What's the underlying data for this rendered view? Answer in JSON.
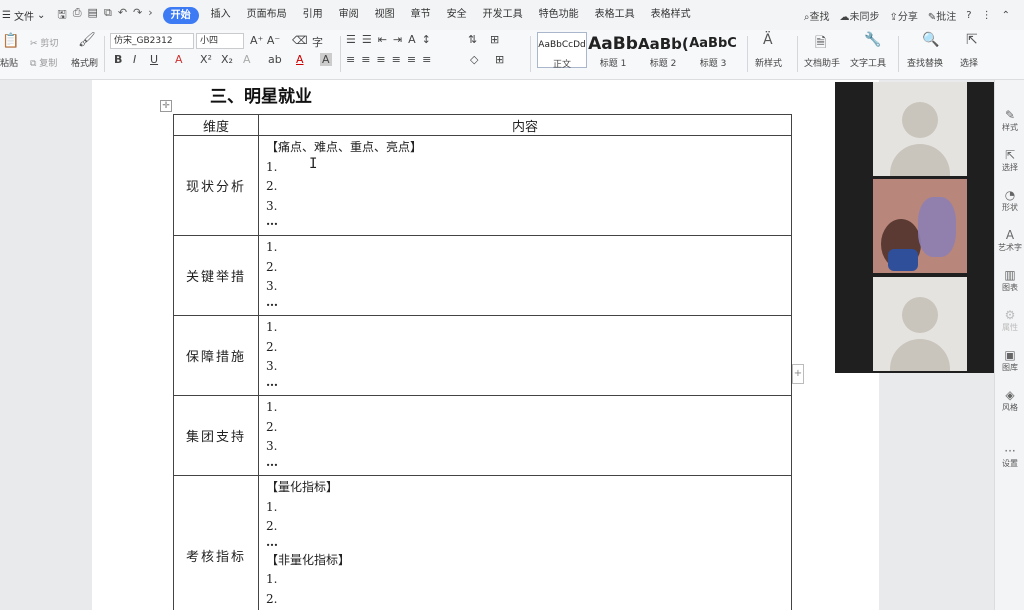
{
  "menu": {
    "file_label": "文件",
    "tabs": [
      "开始",
      "插入",
      "页面布局",
      "引用",
      "审阅",
      "视图",
      "章节",
      "安全",
      "开发工具",
      "特色功能",
      "表格工具",
      "表格样式"
    ],
    "active_tab": "开始",
    "search_label": "查找",
    "sync_label": "未同步",
    "share_label": "分享",
    "annotate_label": "批注"
  },
  "ribbon": {
    "paste": "粘贴",
    "cut": "剪切",
    "copy": "复制",
    "format_painter": "格式刷",
    "font_name": "仿宋_GB2312",
    "font_size": "小四",
    "styles": [
      {
        "sample": "AaBbCcDd",
        "label": "正文"
      },
      {
        "sample": "AaBb",
        "label": "标题 1"
      },
      {
        "sample": "AaBb(",
        "label": "标题 2"
      },
      {
        "sample": "AaBbC",
        "label": "标题 3"
      }
    ],
    "new_style": "新样式",
    "doc_assistant": "文档助手",
    "text_tools": "文字工具",
    "find_replace": "查找替换",
    "select": "选择"
  },
  "document": {
    "heading": "三、明星就业",
    "table": {
      "headers": [
        "维度",
        "内容"
      ],
      "rows": [
        {
          "dimension": "现状分析",
          "lines": [
            "【痛点、难点、重点、亮点】",
            "1.",
            "2.",
            "3.",
            "…"
          ]
        },
        {
          "dimension": "关键举措",
          "lines": [
            "1.",
            "2.",
            "3.",
            "…"
          ]
        },
        {
          "dimension": "保障措施",
          "lines": [
            "1.",
            "2.",
            "3.",
            "…"
          ]
        },
        {
          "dimension": "集团支持",
          "lines": [
            "1.",
            "2.",
            "3.",
            "…"
          ]
        },
        {
          "dimension": "考核指标",
          "lines": [
            "【量化指标】",
            "1.",
            "2.",
            "…",
            "【非量化指标】",
            "1.",
            "2."
          ]
        }
      ]
    }
  },
  "sidebar": {
    "items": [
      "样式",
      "选择",
      "形状",
      "艺术字",
      "图表",
      "属性",
      "图库",
      "风格",
      "设置"
    ]
  }
}
